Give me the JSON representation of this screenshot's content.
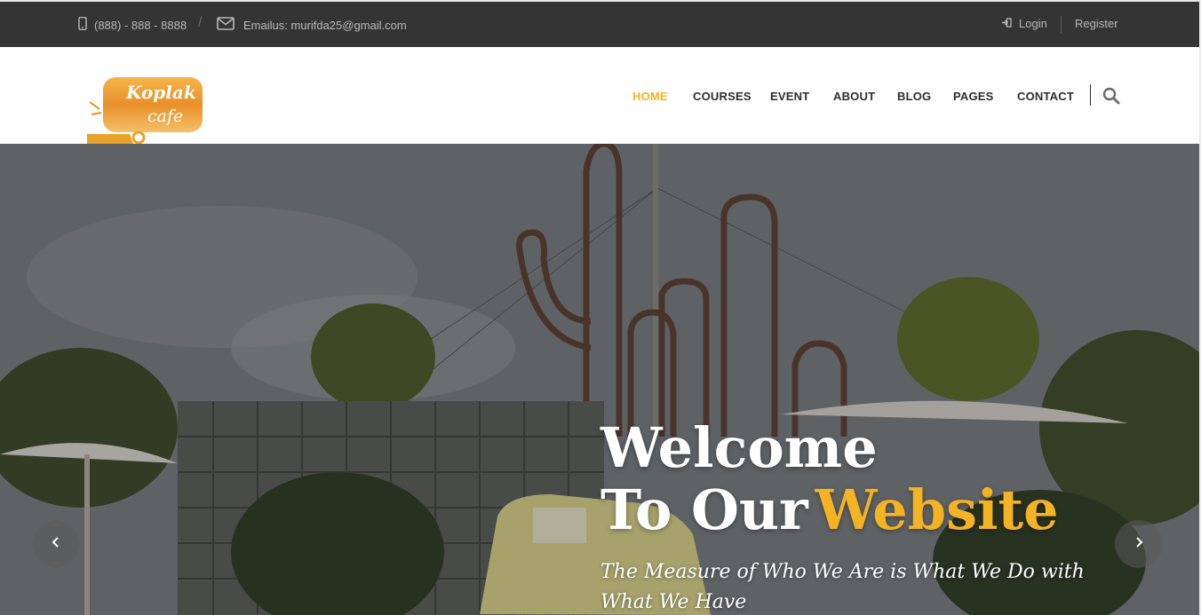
{
  "topbar": {
    "phone": "(888) - 888 - 8888",
    "separator": "/",
    "email": "Emailus: murifda25@gmail.com",
    "login": "Login",
    "register": "Register"
  },
  "header": {
    "logo": {
      "line1": "Koplak",
      "line2": "cafe"
    },
    "nav": [
      {
        "label": "HOME",
        "active": true
      },
      {
        "label": "COURSES",
        "active": false
      },
      {
        "label": "EVENT",
        "active": false
      },
      {
        "label": "ABOUT",
        "active": false
      },
      {
        "label": "BLOG",
        "active": false
      },
      {
        "label": "PAGES",
        "active": false
      },
      {
        "label": "CONTACT",
        "active": false
      }
    ]
  },
  "hero": {
    "title_line1": "Welcome",
    "title_line2_white": "To Our",
    "title_line2_accent": "Website",
    "tagline": "The Measure of Who We Are is What We Do with What We Have"
  },
  "colors": {
    "accent": "#f4b325",
    "topbar_bg": "#343434",
    "nav_text": "#2d2d2d"
  },
  "icons": {
    "phone": "mobile-phone-icon",
    "email": "envelope-icon",
    "login": "sign-in-icon",
    "search": "search-icon",
    "prev": "chevron-left-icon",
    "next": "chevron-right-icon"
  }
}
